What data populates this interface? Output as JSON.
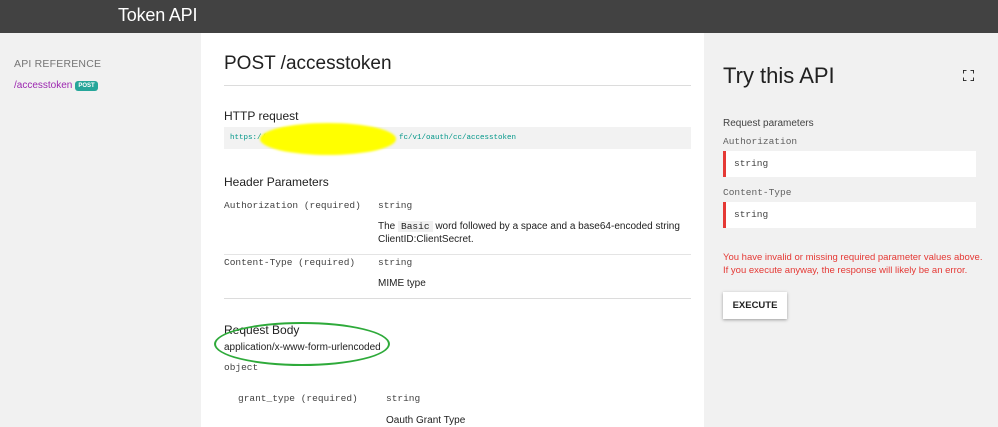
{
  "app": {
    "title": "Token API"
  },
  "sidebar": {
    "heading": "API REFERENCE",
    "items": [
      {
        "label": "/accesstoken",
        "badge": "POST"
      }
    ]
  },
  "main": {
    "title": "POST /accesstoken",
    "http_request": {
      "heading": "HTTP request",
      "url_prefix": "https://",
      "url_suffix": "fc/v1/oauth/cc/accesstoken"
    },
    "header_params": {
      "heading": "Header Parameters",
      "params": [
        {
          "name": "Authorization (required)",
          "type": "string",
          "desc_pre": "The",
          "desc_code": "Basic",
          "desc_post": "word followed by a space and a base64-encoded string",
          "desc_line2": "ClientID:ClientSecret."
        },
        {
          "name": "Content-Type (required)",
          "type": "string",
          "desc": "MIME type"
        }
      ]
    },
    "request_body": {
      "heading": "Request Body",
      "content_type": "application/x-www-form-urlencoded",
      "schema_type": "object",
      "fields": [
        {
          "name": "grant_type (required)",
          "type": "string",
          "desc": "Oauth Grant Type"
        }
      ]
    }
  },
  "panel": {
    "title": "Try this API",
    "section_label": "Request parameters",
    "fields": [
      {
        "label": "Authorization",
        "placeholder": "string"
      },
      {
        "label": "Content-Type",
        "placeholder": "string"
      }
    ],
    "error": "You have invalid or missing required parameter values above. If you execute anyway, the response will likely be an error.",
    "execute_label": "EXECUTE"
  },
  "colors": {
    "topbar": "#424242",
    "link": "#9c27b0",
    "badge": "#26a69a",
    "url": "#009688",
    "error": "#e53935",
    "annotation": "#2eaa3a",
    "redaction": "#ffff00"
  }
}
